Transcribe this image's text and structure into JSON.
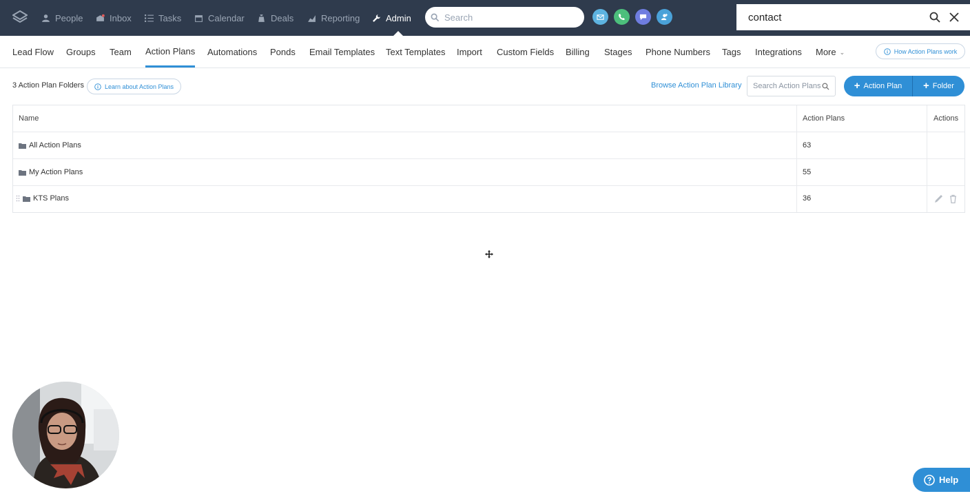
{
  "topnav": {
    "items": [
      {
        "label": "People",
        "icon": "person-icon"
      },
      {
        "label": "Inbox",
        "icon": "inbox-icon"
      },
      {
        "label": "Tasks",
        "icon": "tasks-icon"
      },
      {
        "label": "Calendar",
        "icon": "calendar-icon"
      },
      {
        "label": "Deals",
        "icon": "deals-icon"
      },
      {
        "label": "Reporting",
        "icon": "reporting-icon"
      },
      {
        "label": "Admin",
        "icon": "wrench-icon",
        "active": true
      }
    ],
    "search_placeholder": "Search",
    "quick_actions": [
      "email-icon",
      "phone-icon",
      "chat-icon",
      "add-person-icon"
    ],
    "command_search_value": "contact"
  },
  "subnav": {
    "items": [
      "Lead Flow",
      "Groups",
      "Team",
      "Action Plans",
      "Automations",
      "Ponds",
      "Email Templates",
      "Text Templates",
      "Import",
      "Custom Fields",
      "Billing",
      "Stages",
      "Phone Numbers",
      "Tags",
      "Integrations",
      "More"
    ],
    "active": "Action Plans",
    "how_link": "How Action Plans work"
  },
  "toolbar": {
    "count_label": "3 Action Plan Folders",
    "learn_link": "Learn about Action Plans",
    "browse_link": "Browse Action Plan Library",
    "search_placeholder": "Search Action Plans",
    "add_plan_label": "Action Plan",
    "add_folder_label": "Folder"
  },
  "table": {
    "headers": {
      "name": "Name",
      "plans": "Action Plans",
      "actions": "Actions"
    },
    "rows": [
      {
        "name": "All Action Plans",
        "count": "63"
      },
      {
        "name": "My Action Plans",
        "count": "55"
      },
      {
        "name": "KTS Plans",
        "count": "36"
      }
    ]
  },
  "help_label": "Help",
  "colors": {
    "topbar": "#2f3b4d",
    "accent": "#2f8fd6"
  }
}
